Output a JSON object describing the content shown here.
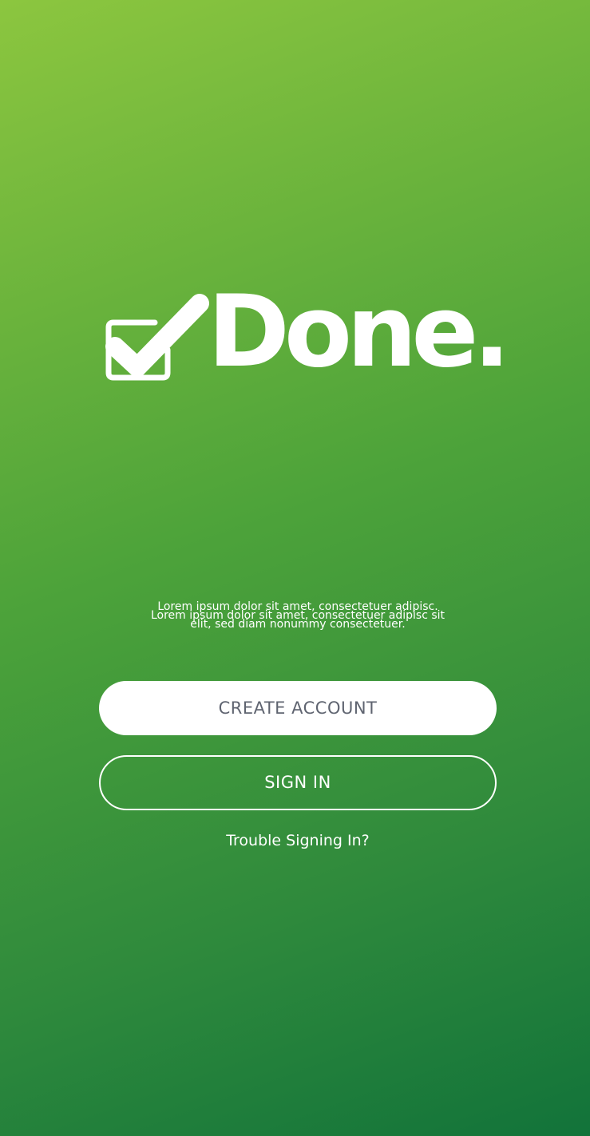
{
  "brand": {
    "name": "Done.",
    "logo_icon": "checkbox-check-icon",
    "color_text": "#ffffff"
  },
  "tagline": {
    "line1": "Lorem ipsum dolor sit amet, consectetuer adipisc.",
    "line2": "Lorem ipsum dolor sit amet, consectetuer adipisc sit",
    "line3": "elit, sed diam nonummy consectetuer."
  },
  "actions": {
    "create_account_label": "CREATE ACCOUNT",
    "sign_in_label": "SIGN IN",
    "trouble_label": "Trouble Signing In?"
  },
  "colors": {
    "gradient_start": "#8cc63f",
    "gradient_end": "#12733a",
    "primary_button_bg": "#ffffff",
    "primary_button_text": "#5f6470"
  }
}
